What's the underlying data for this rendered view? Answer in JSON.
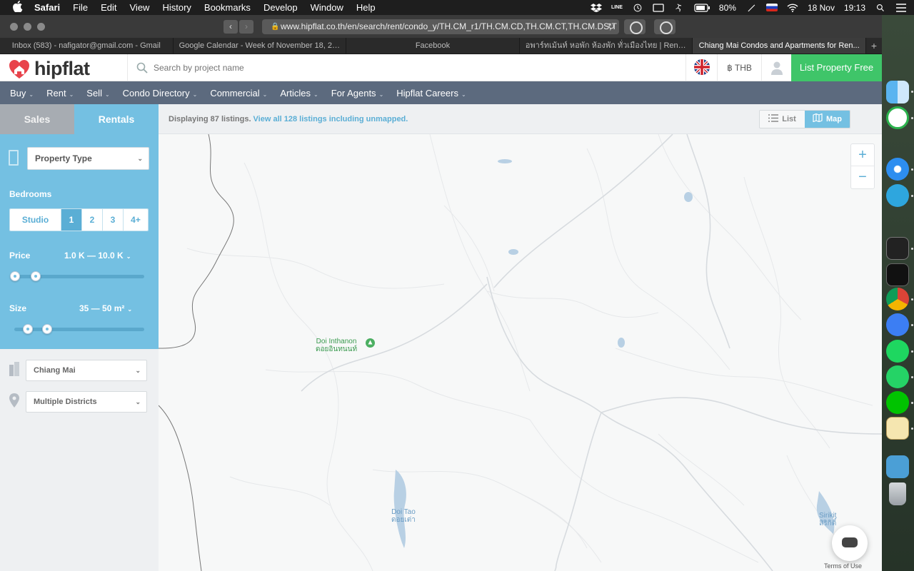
{
  "menubar": {
    "app": "Safari",
    "items": [
      "File",
      "Edit",
      "View",
      "History",
      "Bookmarks",
      "Develop",
      "Window",
      "Help"
    ],
    "battery": "80%",
    "date": "18 Nov",
    "time": "19:13"
  },
  "browser": {
    "url": "www.hipflat.co.th/en/search/rent/condo_y/TH.CM_r1/TH.CM.CD,TH.CM.CT,TH.CM.DS,T",
    "tabs": [
      "Inbox (583) - nafigator@gmail.com - Gmail",
      "Google Calendar - Week of November 18, 2019",
      "Facebook",
      "อพาร์ทเม้นท์ หอพัก ห้องพัก ทั่วเมืองไทย | RentHub.in.th",
      "Chiang Mai Condos and Apartments for Ren..."
    ],
    "active_tab": 4
  },
  "site": {
    "logo": "hipflat",
    "search_placeholder": "Search by project name",
    "currency": "฿ THB",
    "list_property": "List Property Free",
    "brand_green": "#3fc569",
    "accent_blue": "#74c0e2"
  },
  "nav": [
    "Buy",
    "Rent",
    "Sell",
    "Condo Directory",
    "Commercial",
    "Articles",
    "For Agents",
    "Hipflat Careers"
  ],
  "sidebar": {
    "tabs": [
      "Sales",
      "Rentals"
    ],
    "active_tab": "Rentals",
    "property_type": "Property Type",
    "bedrooms_label": "Bedrooms",
    "bedrooms": [
      "Studio",
      "1",
      "2",
      "3",
      "4+"
    ],
    "bedrooms_selected": "1",
    "price_label": "Price",
    "price_value": "1.0 K — 10.0 K",
    "size_label": "Size",
    "size_value": "35 — 50 m²",
    "province": "Chiang Mai",
    "districts": "Multiple Districts"
  },
  "map": {
    "listing_count": "Displaying 87 listings.",
    "view_all": "View all 128 listings including unmapped.",
    "view_list": "List",
    "view_map": "Map",
    "active_view": "Map",
    "zoom_in": "+",
    "zoom_out": "−",
    "poi": [
      {
        "name": "Doi Inthanon",
        "local": "ดอยอินทนนท์"
      },
      {
        "name": "Doi Tao",
        "local": "ดอยเต่า"
      },
      {
        "name": "Sirikit",
        "local": "สิริกิติ์"
      }
    ],
    "terms": "Terms of Use"
  }
}
